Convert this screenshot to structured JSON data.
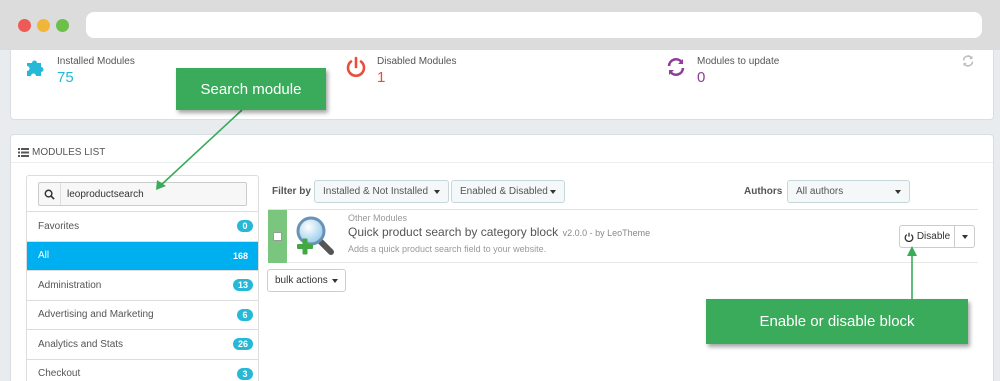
{
  "kpis": {
    "installed": {
      "title": "Installed Modules",
      "value": "75",
      "icon": "puzzle-icon"
    },
    "disabled": {
      "title": "Disabled Modules",
      "value": "1",
      "icon": "power-icon"
    },
    "update": {
      "title": "Modules to update",
      "value": "0",
      "icon": "sync-icon"
    }
  },
  "modules_list": {
    "heading": "MODULES LIST",
    "search": {
      "value": "leoproductsearch",
      "placeholder": ""
    },
    "categories": [
      {
        "label": "Favorites",
        "count": "0"
      },
      {
        "label": "All",
        "count": "168",
        "active": true
      },
      {
        "label": "Administration",
        "count": "13"
      },
      {
        "label": "Advertising and Marketing",
        "count": "6"
      },
      {
        "label": "Analytics and Stats",
        "count": "26"
      },
      {
        "label": "Checkout",
        "count": "3"
      }
    ],
    "filters": {
      "filter_by_label": "Filter by",
      "install_filter": "Installed & Not Installed",
      "enable_filter": "Enabled & Disabled",
      "authors_label": "Authors",
      "authors_filter": "All authors"
    },
    "module": {
      "category": "Other Modules",
      "name": "Quick product search by category block",
      "version": "v2.0.0 - by LeoTheme",
      "description": "Adds a quick product search field to your website.",
      "action_label": "Disable"
    },
    "bulk_label": "bulk actions"
  },
  "callouts": {
    "search": "Search module",
    "enable": "Enable or disable block"
  },
  "colors": {
    "accent": "#00aff0",
    "callout": "#3aab5b",
    "kpi_blue": "#25b9d7",
    "kpi_red": "#e84e3c",
    "kpi_purple": "#8e3d98"
  }
}
